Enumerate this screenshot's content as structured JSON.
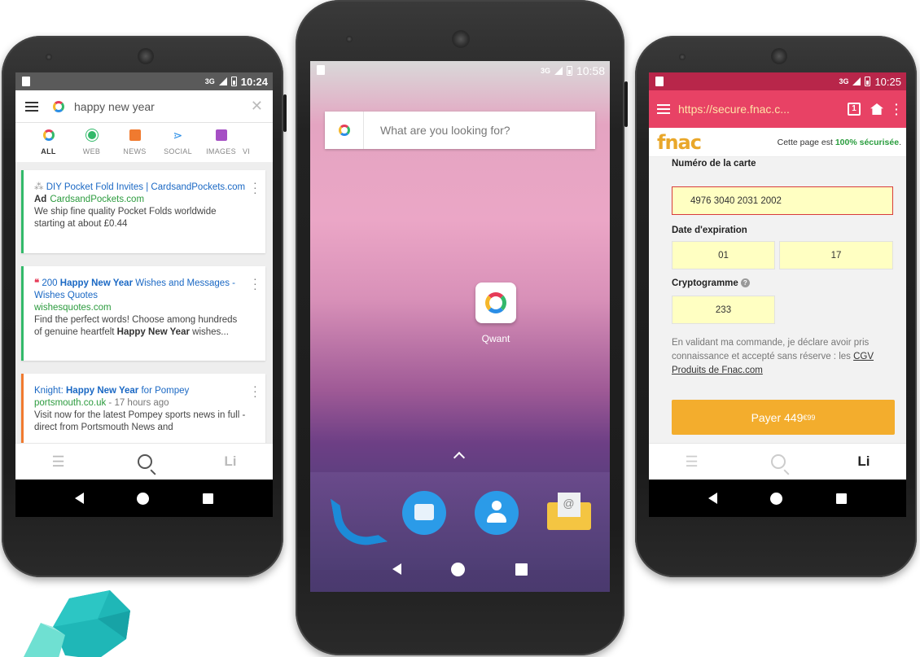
{
  "phone1": {
    "status_time": "10:24",
    "network": "3G",
    "search_query": "happy new year",
    "tabs": [
      {
        "label": "ALL",
        "icon": "qwant-all-icon"
      },
      {
        "label": "WEB",
        "icon": "web-icon"
      },
      {
        "label": "NEWS",
        "icon": "news-icon"
      },
      {
        "label": "SOCIAL",
        "icon": "social-icon"
      },
      {
        "label": "IMAGES",
        "icon": "images-icon"
      },
      {
        "label": "VI",
        "icon": "video-icon"
      }
    ],
    "results": [
      {
        "title": "DIY Pocket Fold Invites | CardsandPockets.com",
        "ad": "Ad",
        "url": "CardsandPockets.com",
        "snippet": "We ship fine quality Pocket Folds worldwide starting at about £0.44",
        "accent": "#33b96a"
      },
      {
        "title_pre": "200 ",
        "title_bold": "Happy New Year",
        "title_post": " Wishes and Messages - Wishes Quotes",
        "url": "wishesquotes.com",
        "snippet_pre": "Find the perfect words! Choose among hundreds of genuine heartfelt ",
        "snippet_bold": "Happy New Year",
        "snippet_post": " wishes...",
        "accent": "#33b96a"
      },
      {
        "title_pre": "Knight: ",
        "title_bold": "Happy New Year",
        "title_post": " for Pompey",
        "url": "portsmouth.co.uk",
        "time": " - 17 hours ago",
        "snippet": "Visit now for the latest Pompey sports news in full - direct from Portsmouth News and",
        "accent": "#f07a2f"
      }
    ]
  },
  "phone2": {
    "status_time": "10:58",
    "network": "3G",
    "search_placeholder": "What are you looking for?",
    "app_label": "Qwant",
    "dock": [
      "phone-icon",
      "messages-icon",
      "contacts-icon",
      "email-icon"
    ]
  },
  "phone3": {
    "status_time": "10:25",
    "network": "3G",
    "url": "https://secure.fnac.c...",
    "tab_count": "1",
    "brand": "fnac",
    "secure_pre": "Cette page est ",
    "secure_bold": "100% sécurisée",
    "secure_post": ".",
    "card_label": "Numéro de la carte",
    "card_value": "4976 3040 2031 2002",
    "expiry_label": "Date d'expiration",
    "expiry_month": "01",
    "expiry_year": "17",
    "cvv_label": "Cryptogramme",
    "cvv_help": "?",
    "cvv_value": "233",
    "legal_text": "En validant ma commande, je déclare avoir pris connaissance et accepté sans réserve : les ",
    "legal_link": "CGV Produits de Fnac.com",
    "pay_label": "Payer 449",
    "pay_cents": "€99"
  },
  "colors": {
    "fnac_bar": "#e84265",
    "fnac_logo": "#e9a72a",
    "pay_button": "#f3ad2d",
    "input_bg": "#ffffc2",
    "link_blue": "#1a68c4",
    "url_green": "#2c9b3e"
  }
}
